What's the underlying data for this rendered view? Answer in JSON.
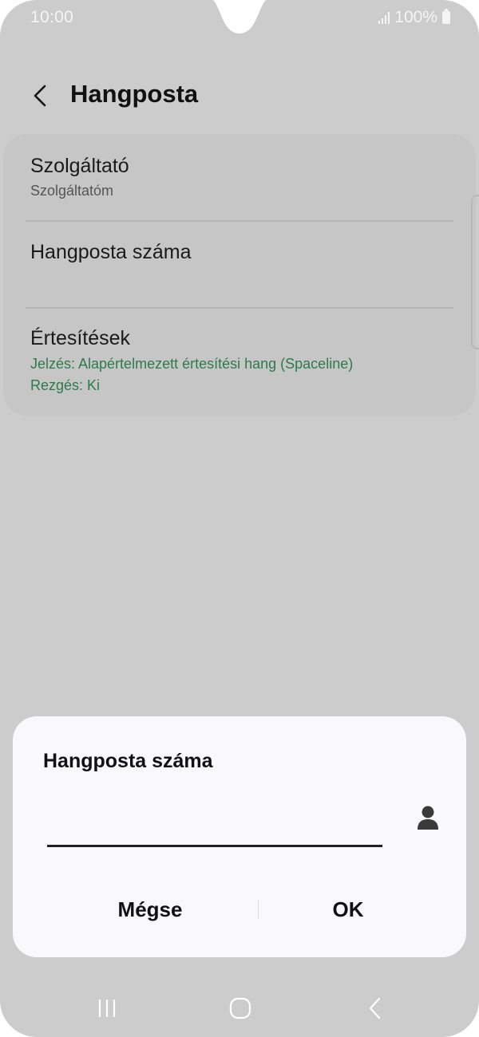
{
  "status_bar": {
    "time": "10:00",
    "battery_text": "100%"
  },
  "header": {
    "title": "Hangposta",
    "back_icon": "chevron-left-icon"
  },
  "settings": {
    "provider": {
      "title": "Szolgáltató",
      "value": "Szolgáltatóm"
    },
    "voicemail_number": {
      "title": "Hangposta száma"
    },
    "notifications": {
      "title": "Értesítések",
      "sound": "Jelzés: Alapértelmezett értesítési hang (Spaceline)",
      "vibration": "Rezgés: Ki"
    }
  },
  "dialog": {
    "title": "Hangposta száma",
    "input_value": "",
    "contact_icon": "person-icon",
    "cancel_label": "Mégse",
    "ok_label": "OK"
  },
  "nav_bar": {
    "recents_icon": "recents-icon",
    "home_icon": "home-icon",
    "back_icon": "back-arrow-icon"
  },
  "colors": {
    "background_dimmed": "#cccccc",
    "accent_green": "#2f7a4c",
    "dialog_bg": "#f9f9fb"
  }
}
